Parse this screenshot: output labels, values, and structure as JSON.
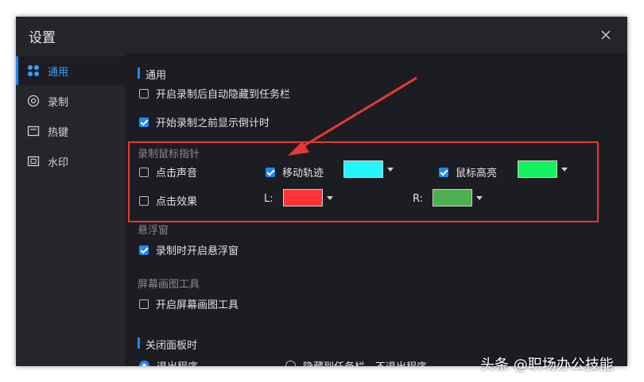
{
  "window": {
    "title": "设置"
  },
  "sidebar": {
    "items": [
      {
        "label": "通用",
        "icon": "grid-icon",
        "active": true
      },
      {
        "label": "录制",
        "icon": "record-icon",
        "active": false
      },
      {
        "label": "热键",
        "icon": "keyboard-icon",
        "active": false
      },
      {
        "label": "水印",
        "icon": "watermark-icon",
        "active": false
      }
    ]
  },
  "general": {
    "title": "通用",
    "auto_hide": {
      "label": "开启录制后自动隐藏到任务栏",
      "checked": false
    },
    "countdown": {
      "label": "开始录制之前显示倒计时",
      "checked": true
    }
  },
  "mouse": {
    "title": "录制鼠标指针",
    "click_sound": {
      "label": "点击声音",
      "checked": false
    },
    "trail": {
      "label": "移动轨迹",
      "checked": true,
      "color": "#23f7fb"
    },
    "highlight": {
      "label": "鼠标高亮",
      "checked": true,
      "color": "#13f35f"
    },
    "click_effect": {
      "label": "点击效果",
      "checked": false
    },
    "left": {
      "label": "L:",
      "color": "#ff3535"
    },
    "right": {
      "label": "R:",
      "color": "#4caf50"
    }
  },
  "float": {
    "title": "悬浮窗",
    "open_float": {
      "label": "录制时开启悬浮窗",
      "checked": true
    }
  },
  "drawing": {
    "title": "屏幕画图工具",
    "open_drawing": {
      "label": "开启屏幕画图工具",
      "checked": false
    }
  },
  "close_panel": {
    "title": "关闭面板时",
    "exit": {
      "label": "退出程序",
      "selected": true
    },
    "hide": {
      "label": "隐藏到任务栏，不退出程序",
      "selected": false
    }
  },
  "watermark_text": "头条 @职场办公技能",
  "colors": {
    "accent": "#1e88ff",
    "annotation": "#e53935"
  }
}
